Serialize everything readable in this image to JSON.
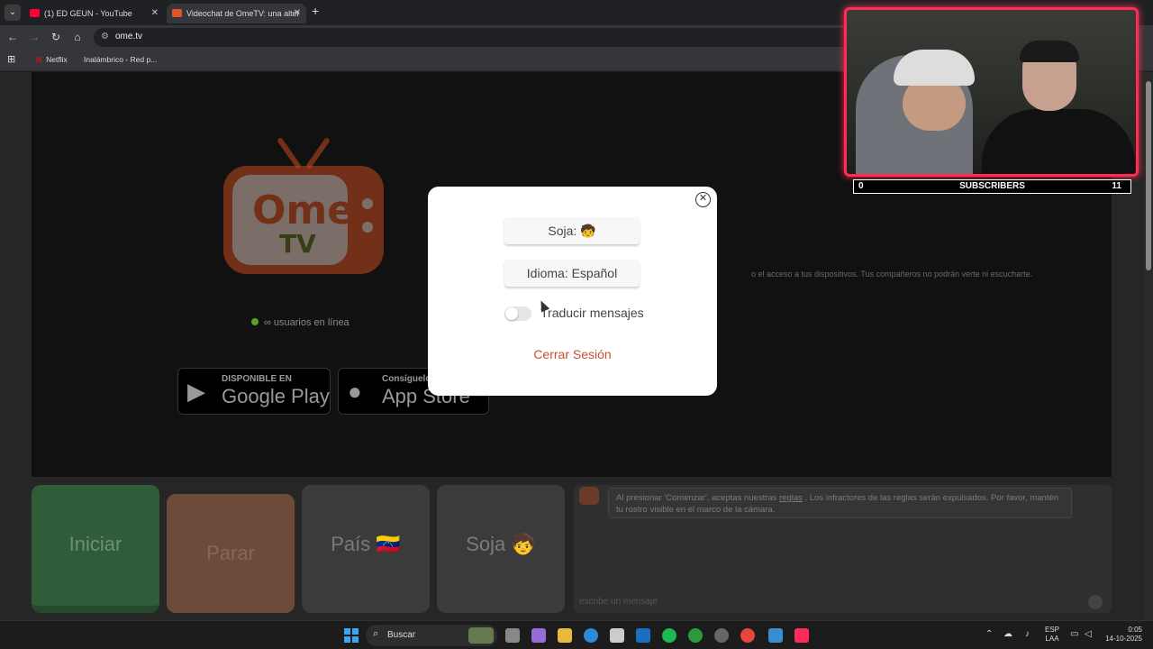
{
  "browser": {
    "tabs": [
      {
        "label": "(1) ED GEUN - YouTube",
        "active": false
      },
      {
        "label": "Videochat de OmeTV: una alter",
        "active": true
      }
    ],
    "url": "ome.tv",
    "bookmarks": [
      {
        "label": "Netflix"
      },
      {
        "label": "Inalámbrico - Red p..."
      }
    ]
  },
  "page": {
    "logo": {
      "word1": "Ome",
      "word2": "TV"
    },
    "online_text": "∞ usuarios en línea",
    "permission_text": "o el acceso a tus dispositivos. Tus compañeros no podrán verte ni escucharte.",
    "google_play": {
      "small": "DISPONIBLE EN",
      "big": "Google Play"
    },
    "app_store": {
      "small": "Consíguelo en el",
      "big": "App Store"
    },
    "controls": {
      "start": "Iniciar",
      "stop": "Parar",
      "country": "País 🇻🇪",
      "gender": "Soja 🧒"
    },
    "chat": {
      "message_pre": "Al presionar 'Comenzar', aceptas nuestras ",
      "message_link": "reglas",
      "message_post": " . Los infractores de las reglas serán expulsados. Por favor, mantén tu rostro visible en el marco de la cámara.",
      "input_placeholder": "escribe un mensaje"
    }
  },
  "modal": {
    "gender_button": "Soja: 🧒",
    "language_button": "Idioma: Español",
    "translate_label": "Traducir mensajes",
    "translate_on": false,
    "logout": "Cerrar Sesión"
  },
  "overlay": {
    "sub_left": "0",
    "sub_label": "SUBSCRIBERS",
    "sub_right": "11"
  },
  "taskbar": {
    "search_label": "Buscar",
    "lang_top": "ESP",
    "lang_bottom": "LAA",
    "time": "0:05",
    "date": "14-10-2025"
  }
}
